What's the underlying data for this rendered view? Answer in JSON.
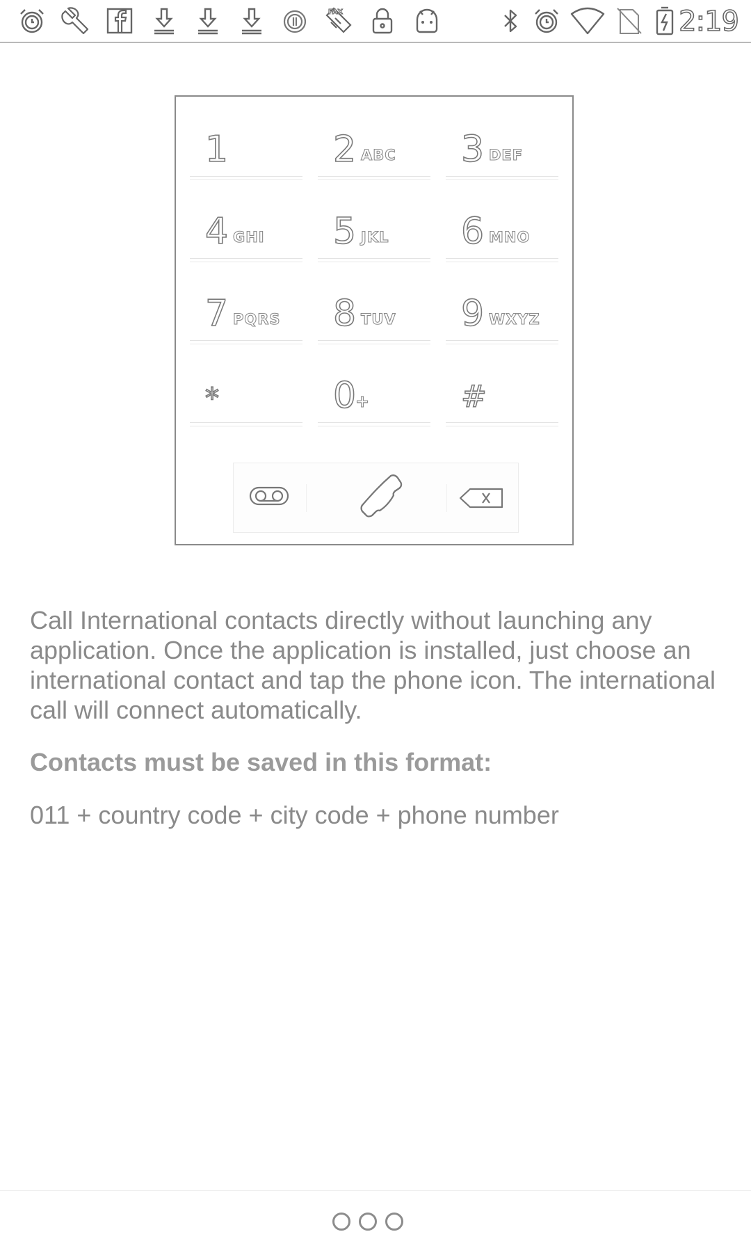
{
  "status_bar": {
    "left_icons": [
      "alarm-clock-icon",
      "wrench-icon",
      "facebook-icon",
      "download-icon",
      "download-icon",
      "download-icon",
      "sync-icon",
      "fax-icon",
      "lock-icon",
      "android-icon"
    ],
    "right_icons": [
      "bluetooth-icon",
      "alarm-clock-icon",
      "wifi-icon",
      "no-sim-icon",
      "battery-charging-icon"
    ],
    "time": "2:19"
  },
  "dialpad": {
    "keys": [
      {
        "digit": "1",
        "letters": ""
      },
      {
        "digit": "2",
        "letters": "ABC"
      },
      {
        "digit": "3",
        "letters": "DEF"
      },
      {
        "digit": "4",
        "letters": "GHI"
      },
      {
        "digit": "5",
        "letters": "JKL"
      },
      {
        "digit": "6",
        "letters": "MNO"
      },
      {
        "digit": "7",
        "letters": "PQRS"
      },
      {
        "digit": "8",
        "letters": "TUV"
      },
      {
        "digit": "9",
        "letters": "WXYZ"
      },
      {
        "digit": "*",
        "letters": ""
      },
      {
        "digit": "0",
        "letters": "+"
      },
      {
        "digit": "#",
        "letters": ""
      }
    ],
    "action_icons": [
      "voicemail-icon",
      "phone-icon",
      "backspace-icon"
    ]
  },
  "content": {
    "description": "Call International contacts directly without launching any application. Once the application is installed, just choose an international contact and tap the phone icon. The international call will connect automatically.",
    "format_heading": "Contacts must be saved in this format:",
    "format_example": "011 + country code + city code + phone number"
  },
  "pager": {
    "total_pages": 3,
    "current_page": 1
  },
  "colors": {
    "outline": "#7a7a7a",
    "text": "#8a8a8a",
    "divider": "#b9b9b9"
  }
}
